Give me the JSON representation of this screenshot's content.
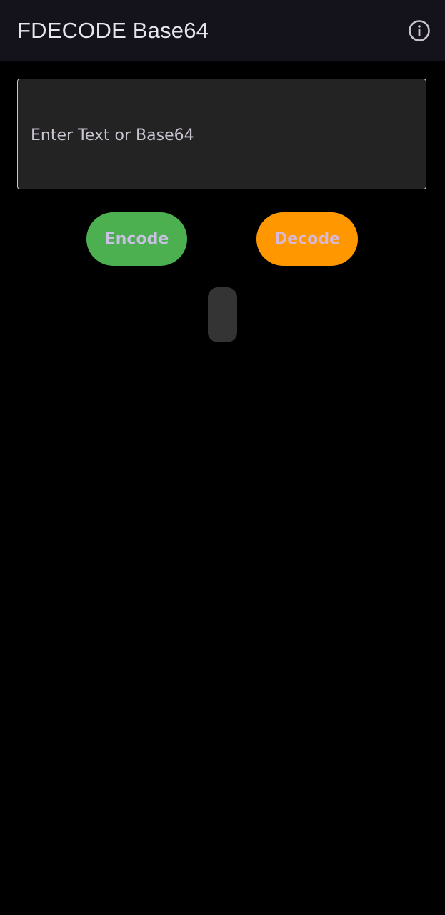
{
  "appbar": {
    "title": "FDECODE Base64",
    "info_icon": "info-circle-icon"
  },
  "input": {
    "placeholder": "Enter Text or Base64",
    "value": ""
  },
  "actions": {
    "encode_label": "Encode",
    "decode_label": "Decode",
    "encode_color": "#4caf50",
    "decode_color": "#ff9800"
  },
  "output": {
    "text": ""
  }
}
